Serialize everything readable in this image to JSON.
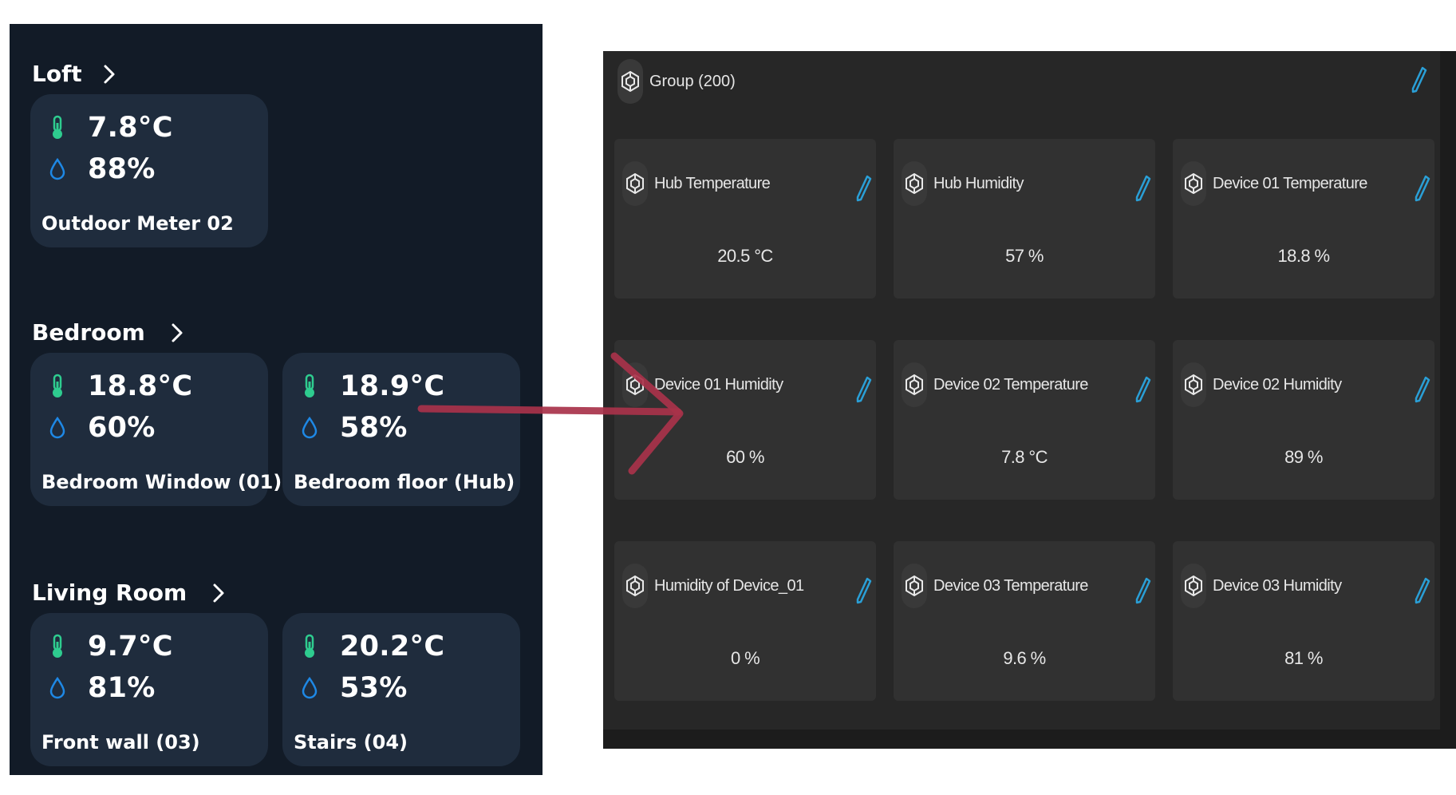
{
  "left_dashboard": {
    "rooms": [
      {
        "name": "Loft",
        "sensors": [
          {
            "temperature": "7.8°C",
            "humidity": "88%",
            "label": "Outdoor Meter 02"
          }
        ]
      },
      {
        "name": "Bedroom",
        "sensors": [
          {
            "temperature": "18.8°C",
            "humidity": "60%",
            "label": "Bedroom Window (01)"
          },
          {
            "temperature": "18.9°C",
            "humidity": "58%",
            "label": "Bedroom floor (Hub)"
          }
        ]
      },
      {
        "name": "Living Room",
        "sensors": [
          {
            "temperature": "9.7°C",
            "humidity": "81%",
            "label": "Front wall (03)"
          },
          {
            "temperature": "20.2°C",
            "humidity": "53%",
            "label": "Stairs (04)"
          }
        ]
      }
    ],
    "icons": {
      "temperature": "thermometer-icon",
      "humidity": "water-drop-icon",
      "chevron": "chevron-right-icon"
    },
    "colors": {
      "background": "#121b27",
      "card": "#1f2c3d",
      "thermometer": "#2ecc8f",
      "drop": "#1e88e5"
    }
  },
  "right_group": {
    "title": "Group (200)",
    "entities": [
      {
        "name": "Hub Temperature",
        "value": "20.5 °C"
      },
      {
        "name": "Hub Humidity",
        "value": "57 %"
      },
      {
        "name": "Device 01 Temperature",
        "value": "18.8 %"
      },
      {
        "name": "Device 01 Humidity",
        "value": "60 %"
      },
      {
        "name": "Device 02 Temperature",
        "value": "7.8 °C"
      },
      {
        "name": "Device 02 Humidity",
        "value": "89 %"
      },
      {
        "name": "Humidity of Device_01",
        "value": "0 %"
      },
      {
        "name": "Device 03 Temperature",
        "value": "9.6 %"
      },
      {
        "name": "Device 03 Humidity",
        "value": "81 %"
      }
    ],
    "icons": {
      "entity": "device-hexagon-icon",
      "edit": "pencil-icon"
    },
    "colors": {
      "background": "#272727",
      "card": "#313131",
      "pencil": "#2a9fd6"
    }
  },
  "annotation": {
    "arrow_color": "#a8324a"
  }
}
